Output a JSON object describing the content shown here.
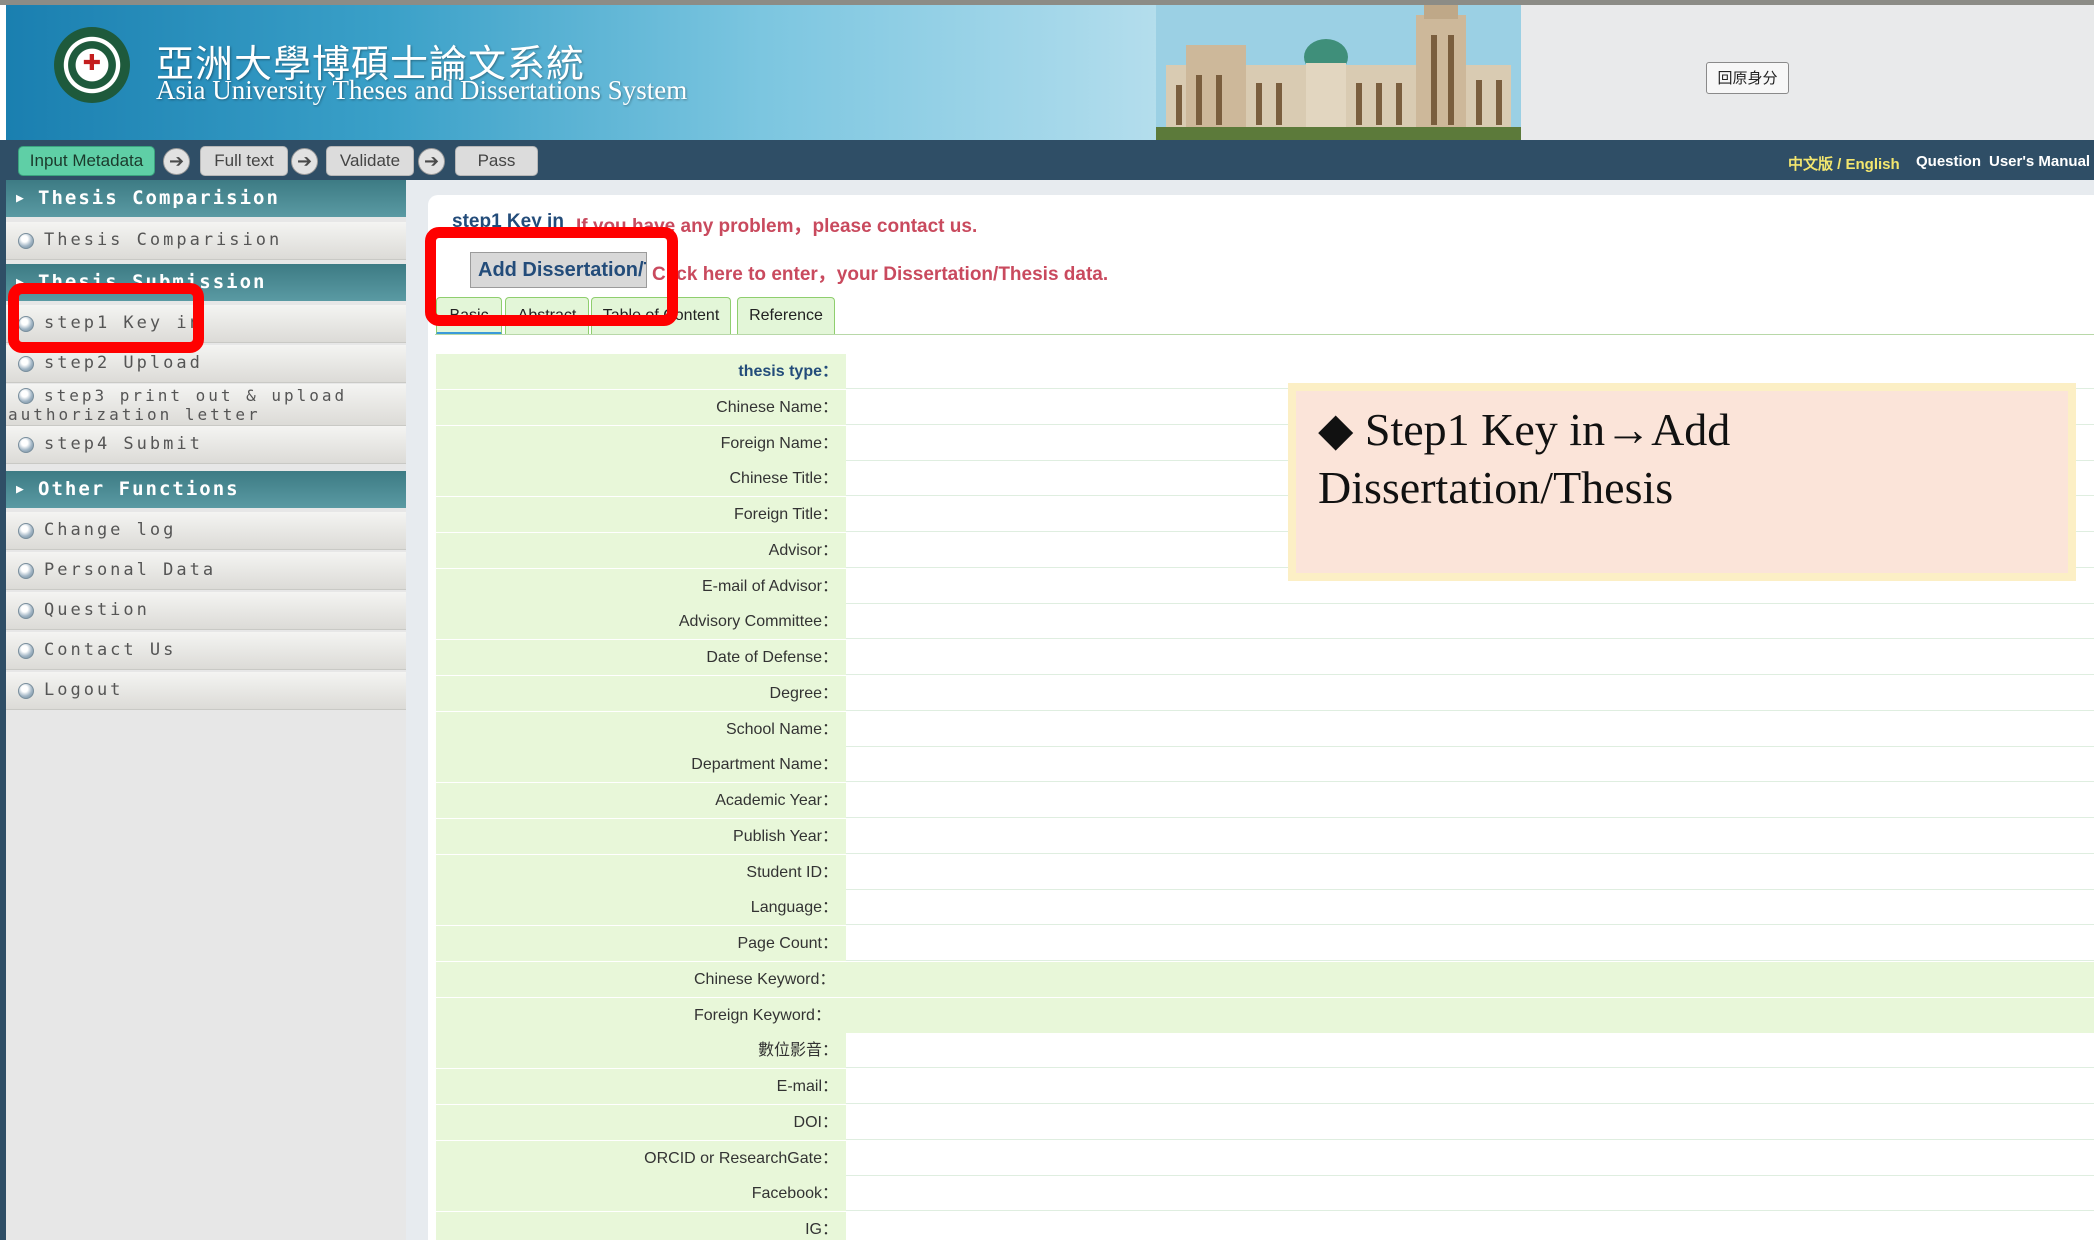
{
  "header": {
    "title_zh": "亞洲大學博碩士論文系統",
    "title_en": "Asia University Theses and Dissertations System",
    "restore_button": "回原身分"
  },
  "nav": {
    "steps": [
      "Input Metadata",
      "Full text",
      "Validate",
      "Pass"
    ],
    "arrow_icon": "➔",
    "lang_link": "中文版 / English",
    "question_link": "Question",
    "manual_link": "User's Manual"
  },
  "sidebar": {
    "section1": {
      "title": "Thesis Comparision",
      "items": [
        "Thesis Comparision"
      ]
    },
    "section2": {
      "title": "Thesis Submission",
      "items": [
        "step1 Key in",
        "step2 Upload",
        "step3 print out & upload",
        "authorization letter",
        "step4 Submit"
      ]
    },
    "section3": {
      "title": "Other Functions",
      "items": [
        "Change log",
        "Personal Data",
        "Question",
        "Contact Us",
        "Logout"
      ]
    }
  },
  "main": {
    "step_title": "step1 Key in",
    "help_text": "If you have any problem，please contact us.",
    "add_button": "Add Dissertation/T",
    "click_text": "Click here to enter，your Dissertation/Thesis data.",
    "tabs": [
      "Basic",
      "Abstract",
      "Table of Content",
      "Reference"
    ],
    "fields": [
      "thesis type：",
      "Chinese Name：",
      "Foreign Name：",
      "Chinese Title：",
      "Foreign Title：",
      "Advisor：",
      "E-mail of Advisor：",
      "Advisory Committee：",
      "Date of Defense：",
      "Degree：",
      "School Name：",
      "Department Name：",
      "Academic Year：",
      "Publish Year：",
      "Student ID：",
      "Language：",
      "Page Count：",
      "Chinese Keyword：",
      "Foreign Keyword：",
      "數位影音：",
      "E-mail：",
      "DOI：",
      "ORCID or ResearchGate：",
      "Facebook：",
      "IG："
    ]
  },
  "callout": {
    "text": "◆ Step1 Key in→Add Dissertation/Thesis"
  },
  "colors": {
    "nav_bg": "#2f4e66",
    "accent_red": "#ff0000",
    "help_text": "#c94a5e",
    "link_blue": "#234c7a",
    "field_bg": "#e8f7d9"
  }
}
